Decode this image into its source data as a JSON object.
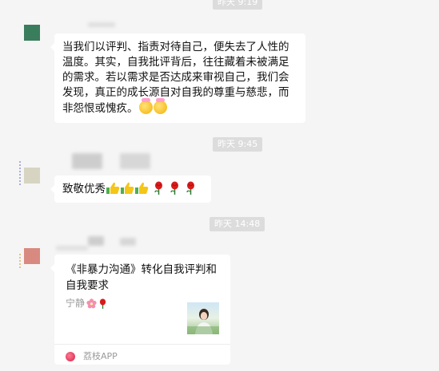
{
  "timestamps": {
    "top": "昨天 9:19",
    "middle": "昨天 9:45",
    "bottom": "昨天 14:48"
  },
  "messages": {
    "first": {
      "text_lines": [
        "当我们以评判、指责对待自己，便失去了人性的",
        "温度。其实，自我批评背后，往往藏着未被满足",
        "的需求。若以需求是否达成来审视自己，我们会",
        "发现，真正的成长源自对自我的尊重与慈悲，而",
        "非怨恨或愧疚。"
      ],
      "emoji": [
        "smiling-face-with-hearts-emoji",
        "smiling-face-with-hearts-emoji"
      ],
      "avatar_color": "#3a7d5c"
    },
    "second": {
      "text": "致敬优秀",
      "emoji": [
        "thumbs-up-emoji",
        "thumbs-up-emoji",
        "thumbs-up-emoji",
        "rose-emoji",
        "rose-emoji",
        "rose-emoji"
      ],
      "avatar_color": "#d7d5c2"
    },
    "third": {
      "card": {
        "title_lines": [
          "《非暴力沟通》转化自我评判和",
          "自我要求"
        ],
        "author": "宁静",
        "author_emoji": [
          "cherry-blossom-emoji",
          "rose-emoji"
        ],
        "app_name": "荔枝APP"
      },
      "avatar_color": "#d98a80"
    }
  },
  "colors": {
    "background": "#f5f5f5",
    "bubble": "#ffffff",
    "timestamp_bg": "#dcdcdc",
    "app_accent": "#e64260"
  }
}
